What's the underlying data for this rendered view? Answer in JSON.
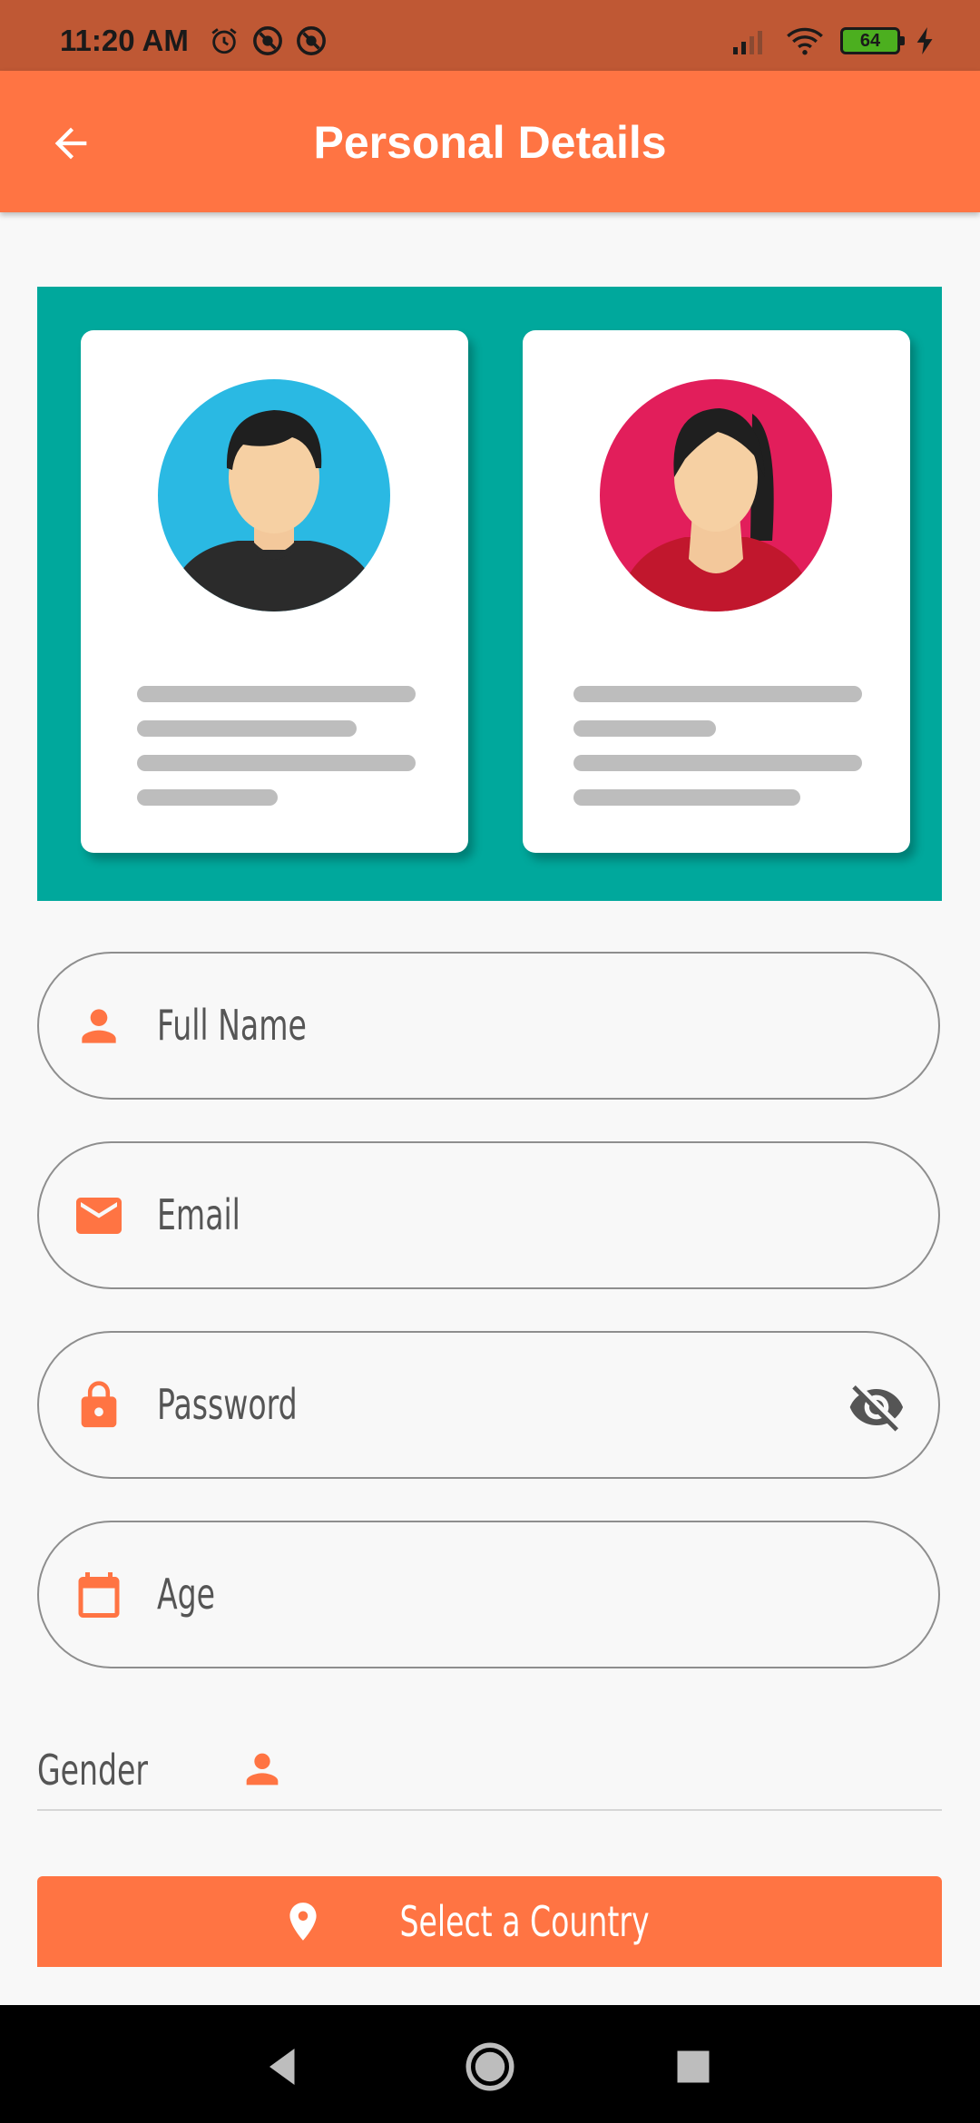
{
  "status_bar": {
    "time": "11:20 AM",
    "battery": "64",
    "left_icons": [
      "alarm-icon",
      "no-disturb-icon",
      "no-disturb-icon"
    ],
    "right_icons": [
      "signal-icon",
      "wifi-icon",
      "battery-icon",
      "charging-icon"
    ]
  },
  "app_bar": {
    "title": "Personal Details",
    "back_icon": "arrow-back-icon"
  },
  "banner": {
    "illustration": "two-profile-cards",
    "colors": {
      "background": "#00a89c",
      "male_avatar": "#2ab9e3",
      "female_avatar": "#e21e5b"
    }
  },
  "form": {
    "full_name": {
      "placeholder": "Full Name",
      "icon": "person-icon"
    },
    "email": {
      "placeholder": "Email",
      "icon": "email-icon"
    },
    "password": {
      "placeholder": "Password",
      "icon": "lock-icon",
      "toggle_icon": "visibility-off-icon"
    },
    "age": {
      "placeholder": "Age",
      "icon": "calendar-icon"
    },
    "gender": {
      "label": "Gender",
      "icon": "person-icon"
    },
    "country_button": {
      "label": "Select a Country",
      "icon": "location-pin-icon"
    }
  },
  "colors": {
    "accent": "#ff7443",
    "status_bar": "#bf5834",
    "field_border": "#8e8e8e",
    "text": "#555555"
  },
  "nav_bar": {
    "items": [
      "back-triangle-icon",
      "home-circle-icon",
      "recents-square-icon"
    ]
  }
}
